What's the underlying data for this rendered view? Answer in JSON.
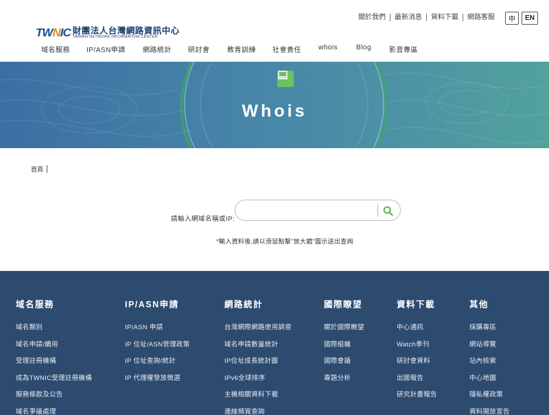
{
  "header": {
    "logo_mark": "TWNIC",
    "logo_cn": "財團法人台灣網路資訊中心",
    "logo_en": "TAIWAN NETWORK INFORMATION CENTER",
    "top_links": [
      "關於我們",
      "最新消息",
      "資料下載",
      "網路客服"
    ],
    "lang_zh": "中",
    "lang_en": "EN",
    "nav": [
      "域名服務",
      "IP/ASN申請",
      "網路統計",
      "研討會",
      "教育訓練",
      "社會責任",
      "whois",
      "Blog",
      "影音專區"
    ]
  },
  "banner": {
    "title": "Whois",
    "icon": "computer-icon",
    "accent": "#6cc160"
  },
  "breadcrumb": {
    "home": "首頁"
  },
  "search": {
    "label": "請輸入網域名稱或IP:",
    "value": "",
    "placeholder": "",
    "note": "*輸入資料後,請以滑鼠點擊\"放大鏡\"圖示送出查詢",
    "icon": "search-icon"
  },
  "footer": {
    "columns": [
      {
        "title": "域名服務",
        "items": [
          "域名類別",
          "域名申請/續用",
          "受理註冊機構",
          "成為TWNIC受理註冊機構",
          "服務條款及公告",
          "域名爭議處理"
        ]
      },
      {
        "title": "IP/ASN申請",
        "items": [
          "IP/ASN 申請",
          "IP 位址/ASN管理政策",
          "IP 位址查詢/統計",
          "IP 代理權發放徵選"
        ]
      },
      {
        "title": "網路統計",
        "items": [
          "台灣網際網路使用調查",
          "域名申請數量統計",
          "IP位址成長統計圖",
          "IPv6全球排序",
          "主機相關資料下載",
          "連線頻寬查詢"
        ]
      },
      {
        "title": "國際瞭望",
        "items": [
          "關於國際瞭望",
          "國際組織",
          "國際會議",
          "專題分析"
        ]
      },
      {
        "title": "資料下載",
        "items": [
          "中心通訊",
          "Watch季刊",
          "研討會資料",
          "出國報告",
          "研究計畫報告"
        ]
      },
      {
        "title": "其他",
        "items": [
          "採購專區",
          "網站導覽",
          "站內檢索",
          "中心地圖",
          "隱私權政策",
          "資料開放宣告"
        ]
      }
    ]
  }
}
